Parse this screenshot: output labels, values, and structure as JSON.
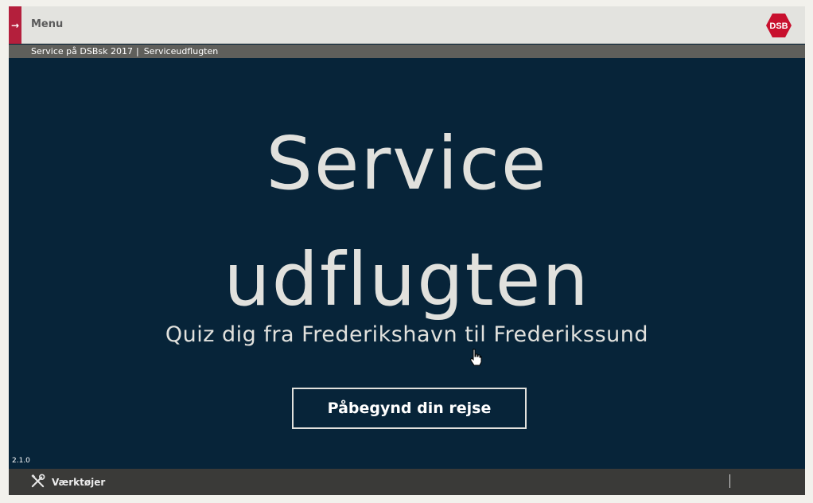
{
  "header": {
    "menu_arrow": "→",
    "menu_label": "Menu",
    "logo_text": "DSB"
  },
  "breadcrumb": {
    "items": [
      "Service på DSBsk 2017",
      "Serviceudflugten"
    ],
    "separator": "|"
  },
  "hero": {
    "title_line1": "Service",
    "title_line2": "udflugten",
    "subtitle": "Quiz dig fra Frederikshavn til Frederikssund",
    "start_button_label": "Påbegynd din rejse"
  },
  "footer": {
    "version": "2.1.0",
    "tools_label": "Værktøjer",
    "tools_icon": "tools-icon"
  },
  "colors": {
    "background": "#072439",
    "accent": "#b41f3c",
    "logo": "#c8102e",
    "topbar": "#e3e3df",
    "breadcrumb_bar": "#5f5f5b",
    "bottombar": "#3a3a38",
    "text_light": "#e1e1dd"
  }
}
